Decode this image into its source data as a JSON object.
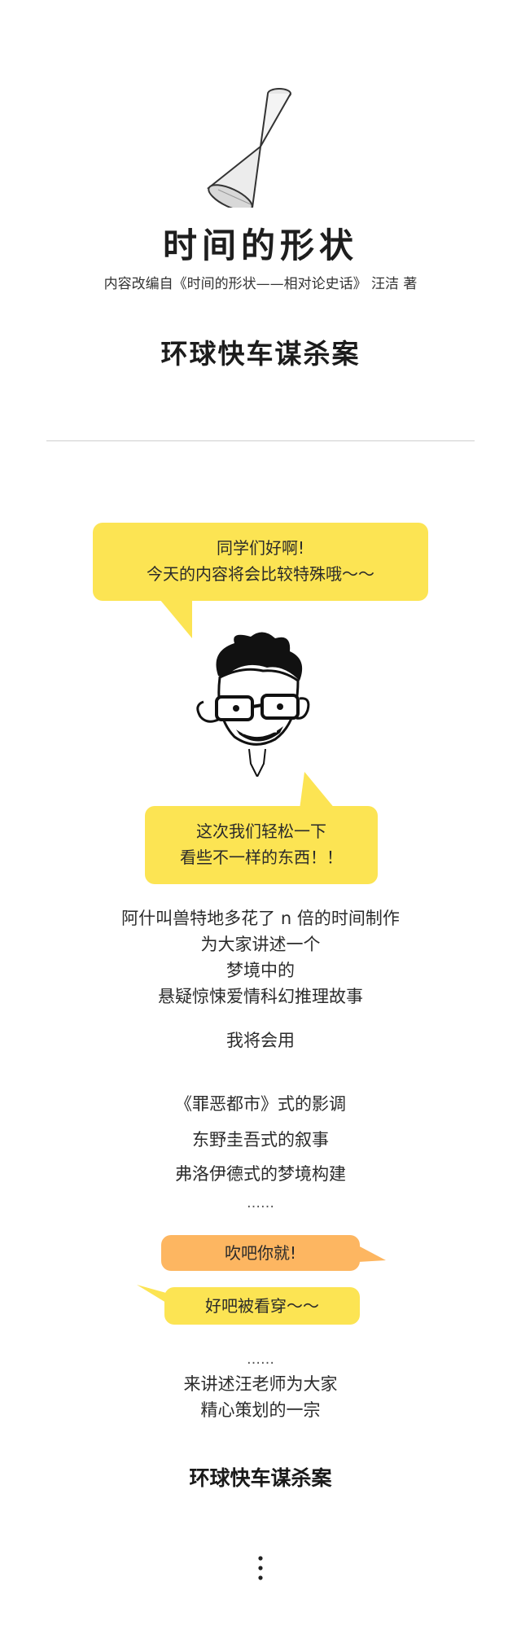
{
  "header": {
    "title": "时间的形状",
    "subtitle": "内容改编自《时间的形状——相对论史话》 汪洁 著",
    "case_title": "环球快车谋杀案"
  },
  "bubbles": {
    "greeting_line1": "同学们好啊!",
    "greeting_line2": "今天的内容将会比较特殊哦～～",
    "relax_line1": "这次我们轻松一下",
    "relax_line2": "看些不一样的东西！！",
    "brag": "吹吧你就!",
    "caught": "好吧被看穿～～"
  },
  "story": {
    "p1_l1": "阿什叫兽特地多花了 n 倍的时间制作",
    "p1_l2": "为大家讲述一个",
    "p1_l3": "梦境中的",
    "p1_l4": "悬疑惊悚爱情科幻推理故事",
    "p2": "我将会用",
    "list1": "《罪恶都市》式的影调",
    "list2": "东野圭吾式的叙事",
    "list3": "弗洛伊德式的梦境构建",
    "ellipsis1": "……",
    "ellipsis2": "……",
    "p3_l1": "来讲述汪老师为大家",
    "p3_l2": "精心策划的一宗",
    "case_bold": "环球快车谋杀案"
  },
  "colors": {
    "bubble_yellow": "#fce453",
    "bubble_orange": "#fdb661",
    "divider": "#cfcfcf"
  },
  "icons": {
    "hourglass": "hourglass-icon",
    "teacher": "cartoon-teacher-face",
    "more": "vertical-dots-icon"
  }
}
